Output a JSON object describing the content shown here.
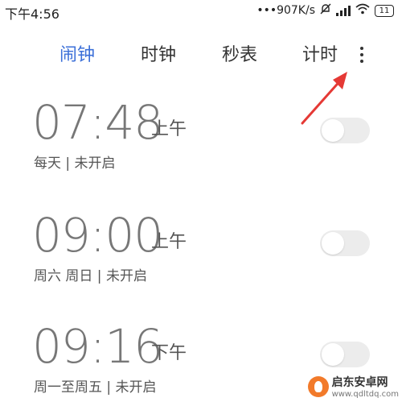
{
  "status_bar": {
    "time": "下午4:56",
    "network_speed": "•••907K/s",
    "mute_icon": "bell-off-icon",
    "signal_icon": "signal-icon",
    "wifi_icon": "wifi-icon",
    "battery": "11"
  },
  "tabs": [
    {
      "label": "闹钟",
      "active": true
    },
    {
      "label": "时钟",
      "active": false
    },
    {
      "label": "秒表",
      "active": false
    },
    {
      "label": "计时",
      "active": false
    }
  ],
  "more_menu_icon": "more-vertical-icon",
  "annotation_arrow_color": "#e53935",
  "accent_color": "#3b6fd8",
  "alarms": [
    {
      "time": "07:48",
      "ampm": "上午",
      "repeat": "每天 | 未开启",
      "enabled": false
    },
    {
      "time": "09:00",
      "ampm": "上午",
      "repeat": "周六 周日 | 未开启",
      "enabled": false
    },
    {
      "time": "09:16",
      "ampm": "下午",
      "repeat": "周一至周五 | 未开启",
      "enabled": false
    }
  ],
  "watermark": {
    "title": "启东安卓网",
    "url": "www.qdltdq.com"
  }
}
